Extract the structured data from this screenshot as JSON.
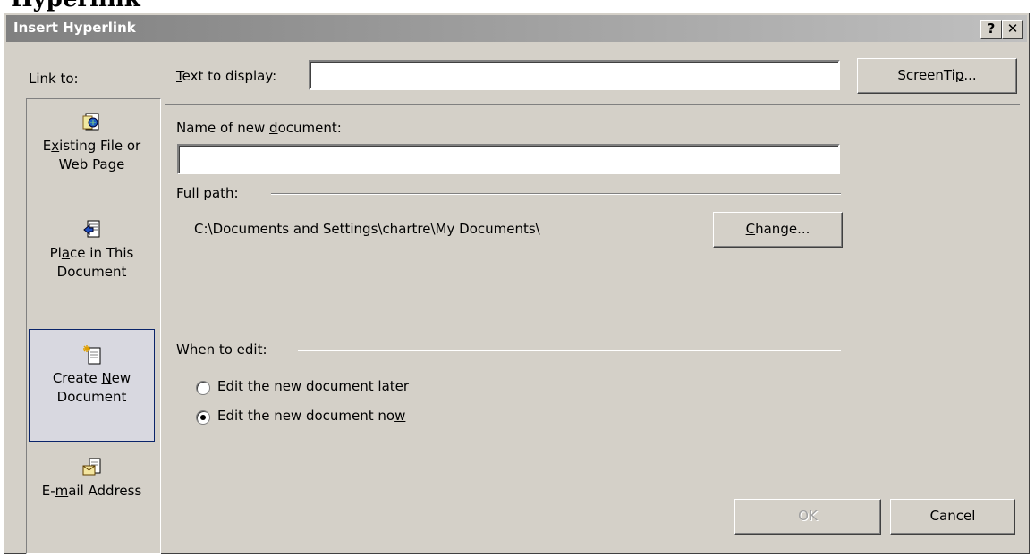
{
  "page_heading": "Hyperlink",
  "window": {
    "title": "Insert Hyperlink",
    "help_label": "?",
    "close_label": "✕"
  },
  "sidebar": {
    "title": "Link to:",
    "items": [
      {
        "line1_pre": "E",
        "line1_u": "x",
        "line1_post": "isting File or",
        "line2": "Web Page",
        "icon": "existing-file-web-page-icon"
      },
      {
        "line1_pre": "Pl",
        "line1_u": "a",
        "line1_post": "ce in This",
        "line2": "Document",
        "icon": "place-in-document-icon"
      },
      {
        "line1_pre": "Create ",
        "line1_u": "N",
        "line1_post": "ew",
        "line2": "Document",
        "icon": "new-document-icon",
        "selected": true
      },
      {
        "line1_pre": "E-",
        "line1_u": "m",
        "line1_post": "ail Address",
        "line2": "",
        "icon": "email-address-icon"
      }
    ]
  },
  "text_to_display": {
    "label_u": "T",
    "label_rest": "ext to display:",
    "value": ""
  },
  "screentip_button": {
    "pre": "ScreenTi",
    "u": "p",
    "post": "..."
  },
  "new_document_name": {
    "label_pre": "Name of new ",
    "label_u": "d",
    "label_post": "ocument:",
    "value": ""
  },
  "full_path": {
    "label": "Full path:",
    "value": "C:\\Documents and Settings\\chartre\\My Documents\\"
  },
  "change_button": {
    "u": "C",
    "post": "hange..."
  },
  "when_to_edit": {
    "label": "When to edit:",
    "options": [
      {
        "pre": "Edit the new document ",
        "u": "l",
        "post": "ater",
        "checked": false
      },
      {
        "pre": "Edit the new document no",
        "u": "w",
        "post": "",
        "checked": true
      }
    ]
  },
  "ok_button": "OK",
  "cancel_button": "Cancel",
  "colors": {
    "dialog_bg": "#d4d0c8",
    "title_gradient_start": "#808080",
    "title_gradient_end": "#c0c0c0",
    "selection_border": "#0a246a"
  }
}
